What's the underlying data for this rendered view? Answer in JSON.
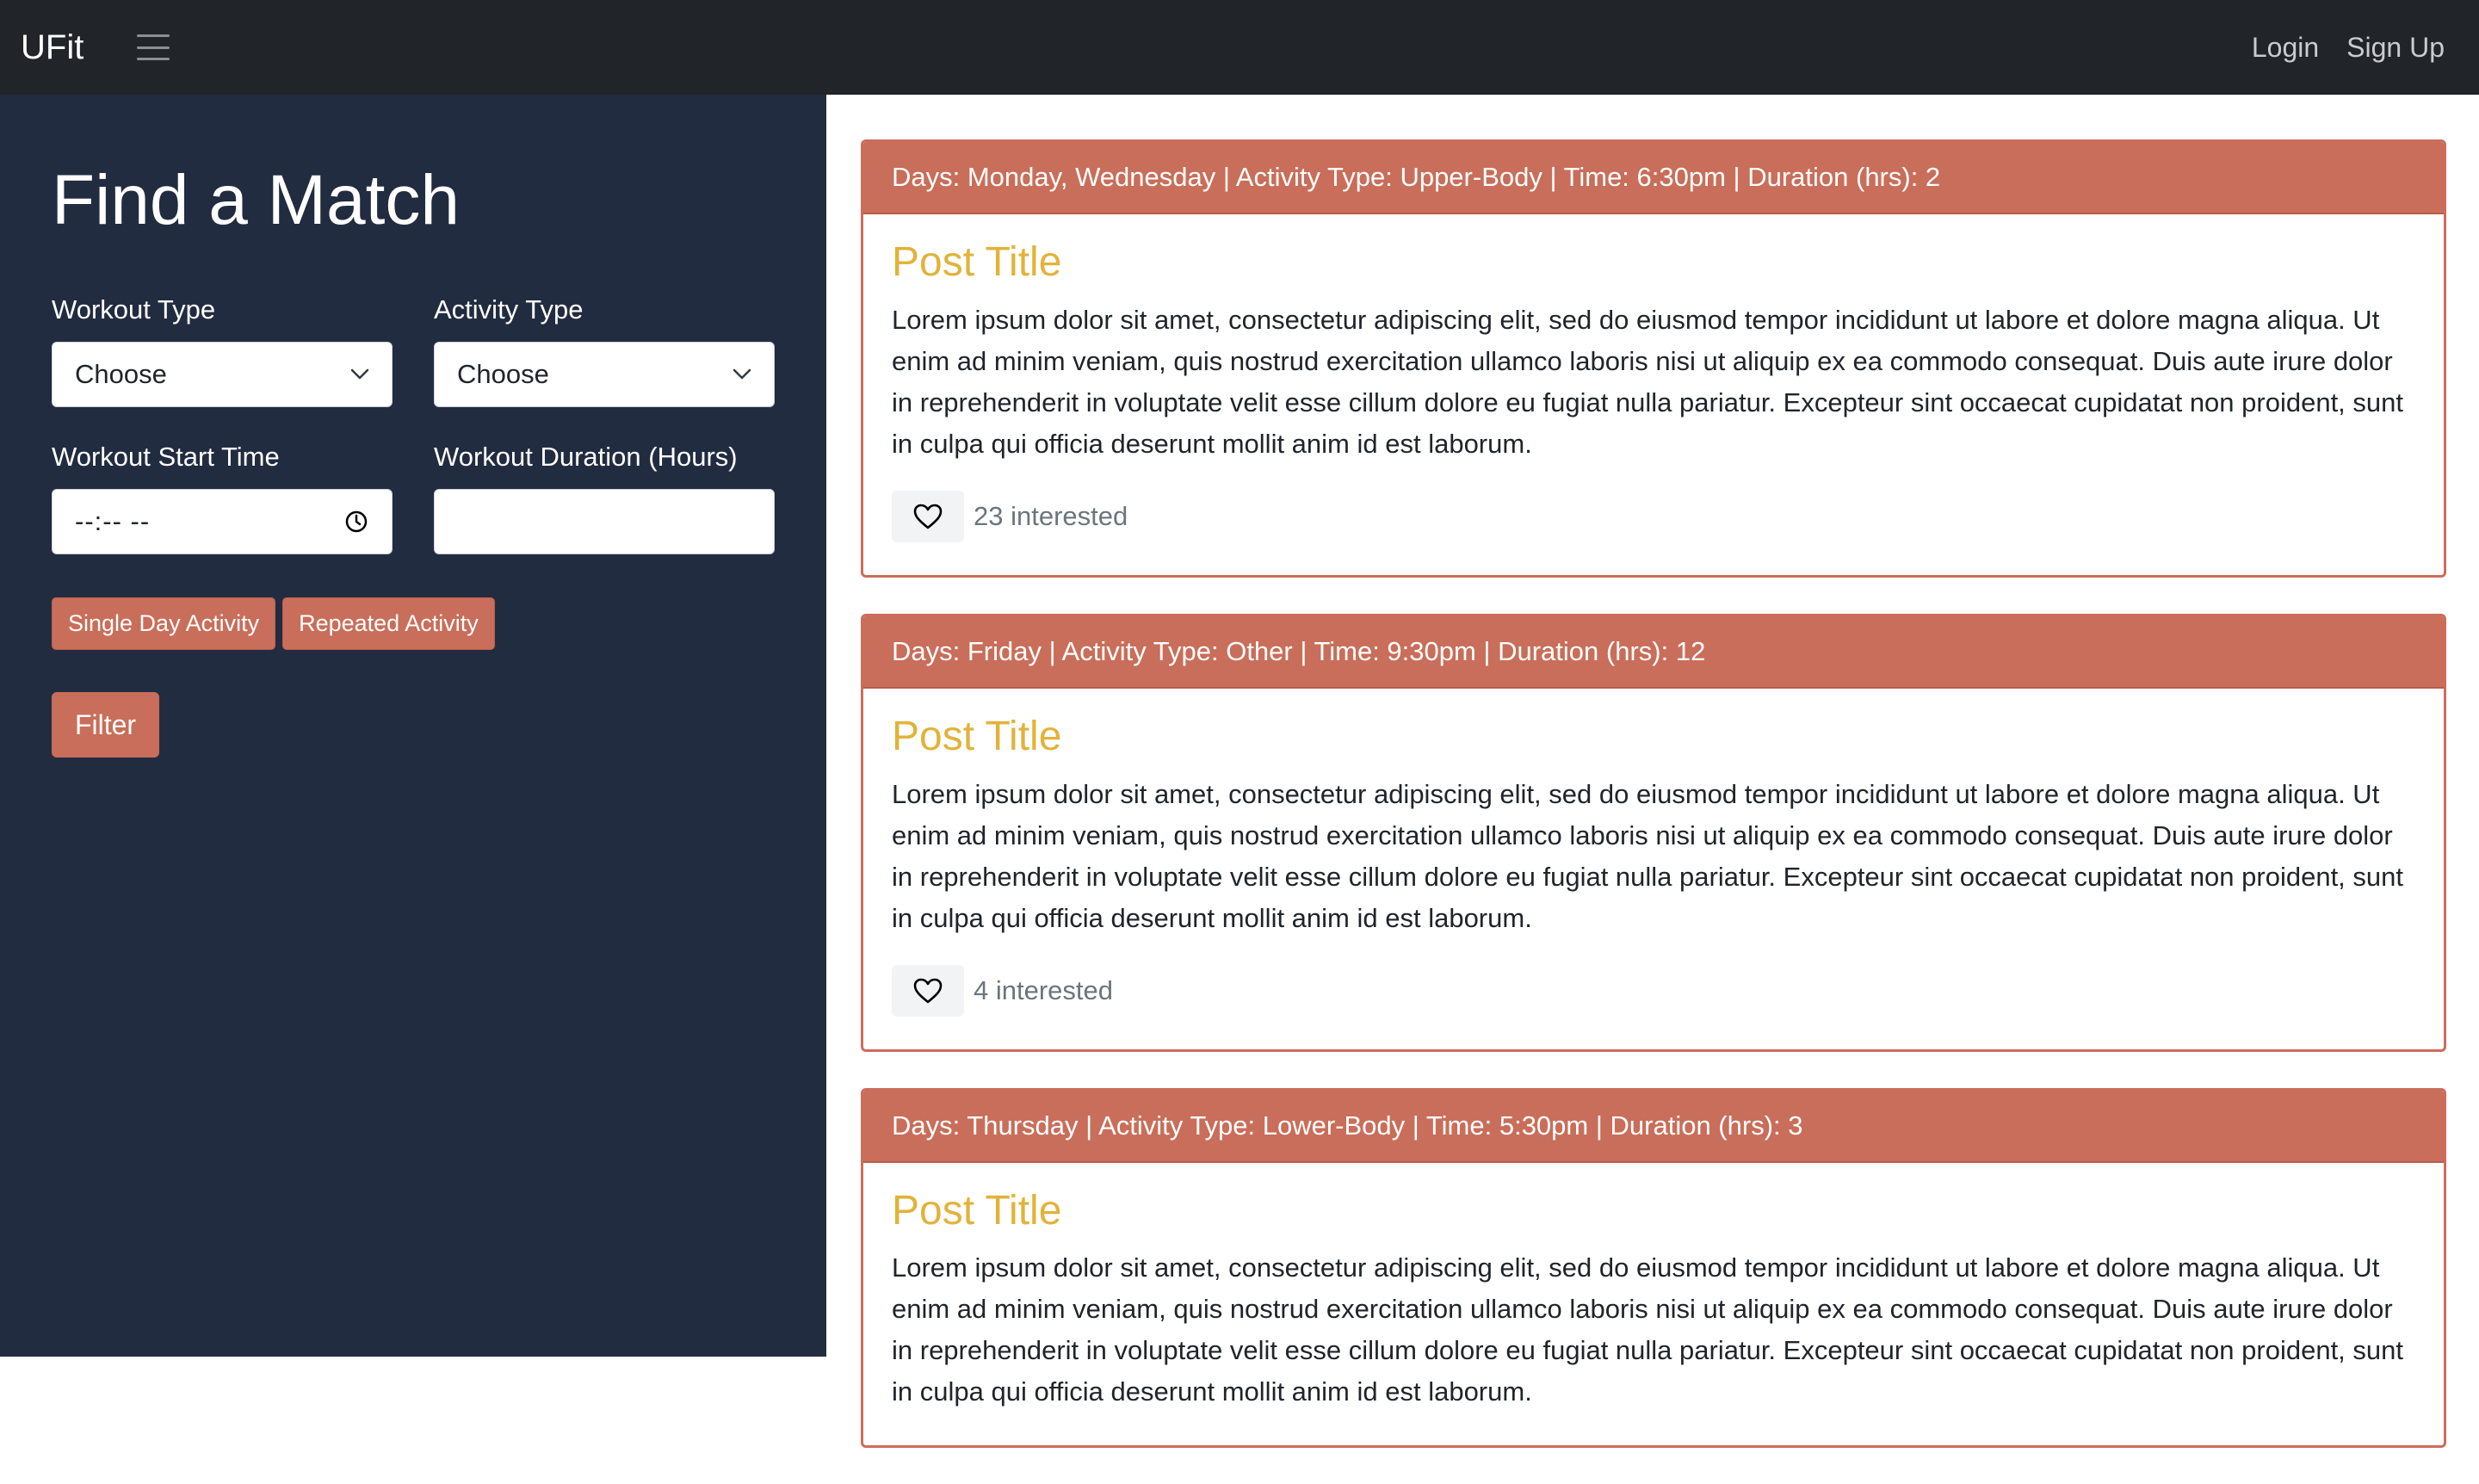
{
  "navbar": {
    "brand": "UFit",
    "links": {
      "login": "Login",
      "signup": "Sign Up"
    }
  },
  "sidebar": {
    "title": "Find a Match",
    "workout_type": {
      "label": "Workout Type",
      "value": "Choose"
    },
    "activity_type": {
      "label": "Activity Type",
      "value": "Choose"
    },
    "start_time": {
      "label": "Workout Start Time",
      "value": "--:-- --"
    },
    "duration": {
      "label": "Workout Duration (Hours)",
      "value": ""
    },
    "buttons": {
      "single_day": "Single Day Activity",
      "repeated": "Repeated Activity",
      "filter": "Filter"
    }
  },
  "posts": [
    {
      "header": "Days: Monday, Wednesday | Activity Type: Upper-Body | Time: 6:30pm | Duration (hrs): 2",
      "title": "Post Title",
      "body": "Lorem ipsum dolor sit amet, consectetur adipiscing elit, sed do eiusmod tempor incididunt ut labore et dolore magna aliqua. Ut enim ad minim veniam, quis nostrud exercitation ullamco laboris nisi ut aliquip ex ea commodo consequat. Duis aute irure dolor in reprehenderit in voluptate velit esse cillum dolore eu fugiat nulla pariatur. Excepteur sint occaecat cupidatat non proident, sunt in culpa qui officia deserunt mollit anim id est laborum.",
      "interested": "23 interested"
    },
    {
      "header": "Days: Friday | Activity Type: Other | Time: 9:30pm | Duration (hrs): 12",
      "title": "Post Title",
      "body": "Lorem ipsum dolor sit amet, consectetur adipiscing elit, sed do eiusmod tempor incididunt ut labore et dolore magna aliqua. Ut enim ad minim veniam, quis nostrud exercitation ullamco laboris nisi ut aliquip ex ea commodo consequat. Duis aute irure dolor in reprehenderit in voluptate velit esse cillum dolore eu fugiat nulla pariatur. Excepteur sint occaecat cupidatat non proident, sunt in culpa qui officia deserunt mollit anim id est laborum.",
      "interested": "4 interested"
    },
    {
      "header": "Days: Thursday | Activity Type: Lower-Body | Time: 5:30pm | Duration (hrs): 3",
      "title": "Post Title",
      "body": "Lorem ipsum dolor sit amet, consectetur adipiscing elit, sed do eiusmod tempor incididunt ut labore et dolore magna aliqua. Ut enim ad minim veniam, quis nostrud exercitation ullamco laboris nisi ut aliquip ex ea commodo consequat. Duis aute irure dolor in reprehenderit in voluptate velit esse cillum dolore eu fugiat nulla pariatur. Excepteur sint occaecat cupidatat non proident, sunt in culpa qui officia deserunt mollit anim id est laborum.",
      "interested": ""
    }
  ],
  "icons": {
    "menu": "hamburger-menu-icon",
    "select": "chevron-down-icon",
    "time": "clock-icon",
    "like": "heart-icon"
  },
  "colors": {
    "navbar": "#212529",
    "sidebar": "#222c40",
    "accent": "#c96e5a",
    "post_title": "#e2b33b"
  }
}
